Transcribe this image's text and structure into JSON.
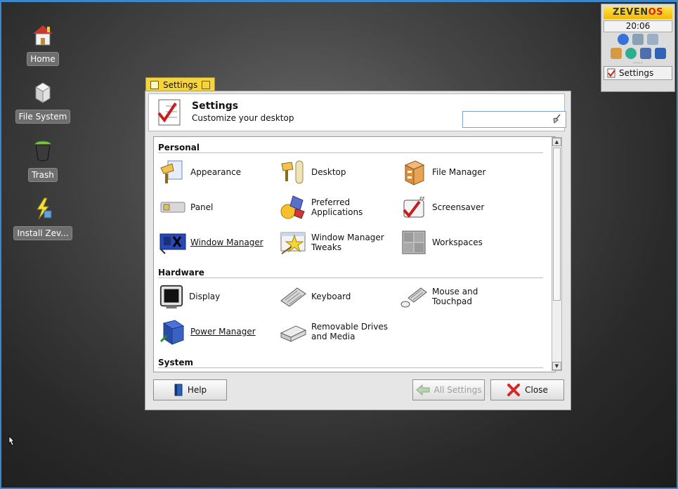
{
  "desktop": {
    "icons": [
      {
        "label": "Home"
      },
      {
        "label": "File System"
      },
      {
        "label": "Trash"
      },
      {
        "label": "Install Zev..."
      }
    ]
  },
  "panel": {
    "brand_prefix": "ZEVEN",
    "brand_suffix": "OS",
    "clock": "20:06",
    "dots": ".....",
    "task_label": "Settings"
  },
  "window": {
    "tab_title": "Settings",
    "header_title": "Settings",
    "header_subtitle": "Customize your desktop",
    "search": {
      "value": "",
      "placeholder": ""
    },
    "sections": [
      {
        "title": "Personal"
      },
      {
        "title": "Hardware"
      },
      {
        "title": "System"
      }
    ],
    "items": {
      "appearance": "Appearance",
      "desktop": "Desktop",
      "file_manager": "File Manager",
      "panel": "Panel",
      "preferred_apps": "Preferred\nApplications",
      "screensaver": "Screensaver",
      "window_manager": "Window Manager",
      "wm_tweaks": "Window Manager\nTweaks",
      "workspaces": "Workspaces",
      "display": "Display",
      "keyboard": "Keyboard",
      "mouse": "Mouse and\nTouchpad",
      "power_manager": "Power Manager",
      "removable": "Removable Drives\nand Media"
    },
    "buttons": {
      "help": "Help",
      "all_settings": "All Settings",
      "close": "Close"
    }
  },
  "colors": {
    "accent_frame": "#3a88c9",
    "title_tab": "#f7d43a",
    "brand_red": "#d62020"
  }
}
